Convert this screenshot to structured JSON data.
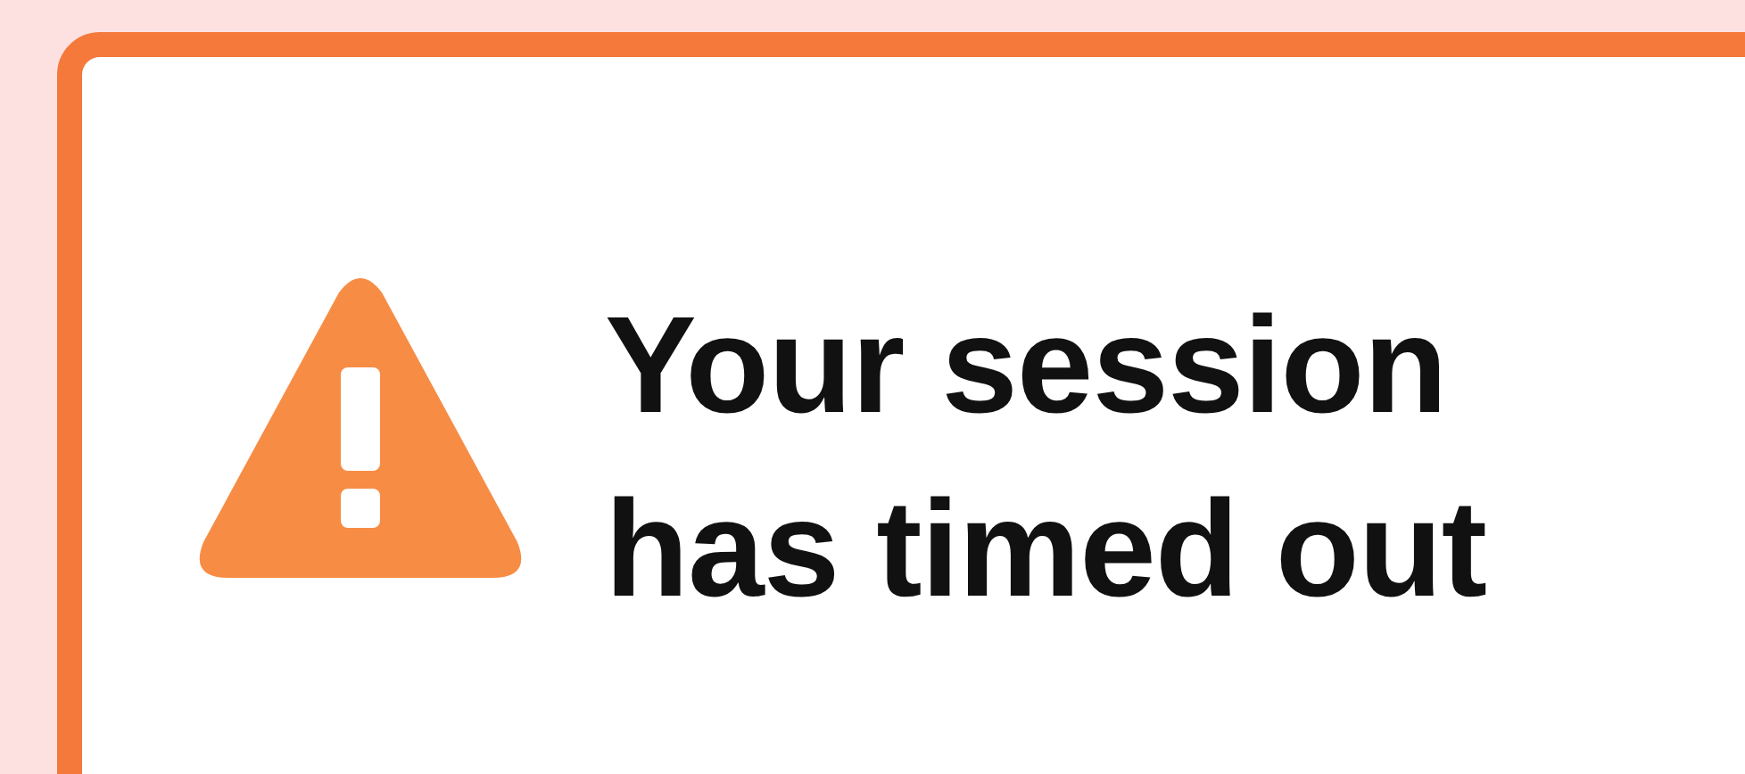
{
  "alert": {
    "message": "Your session has timed out"
  }
}
